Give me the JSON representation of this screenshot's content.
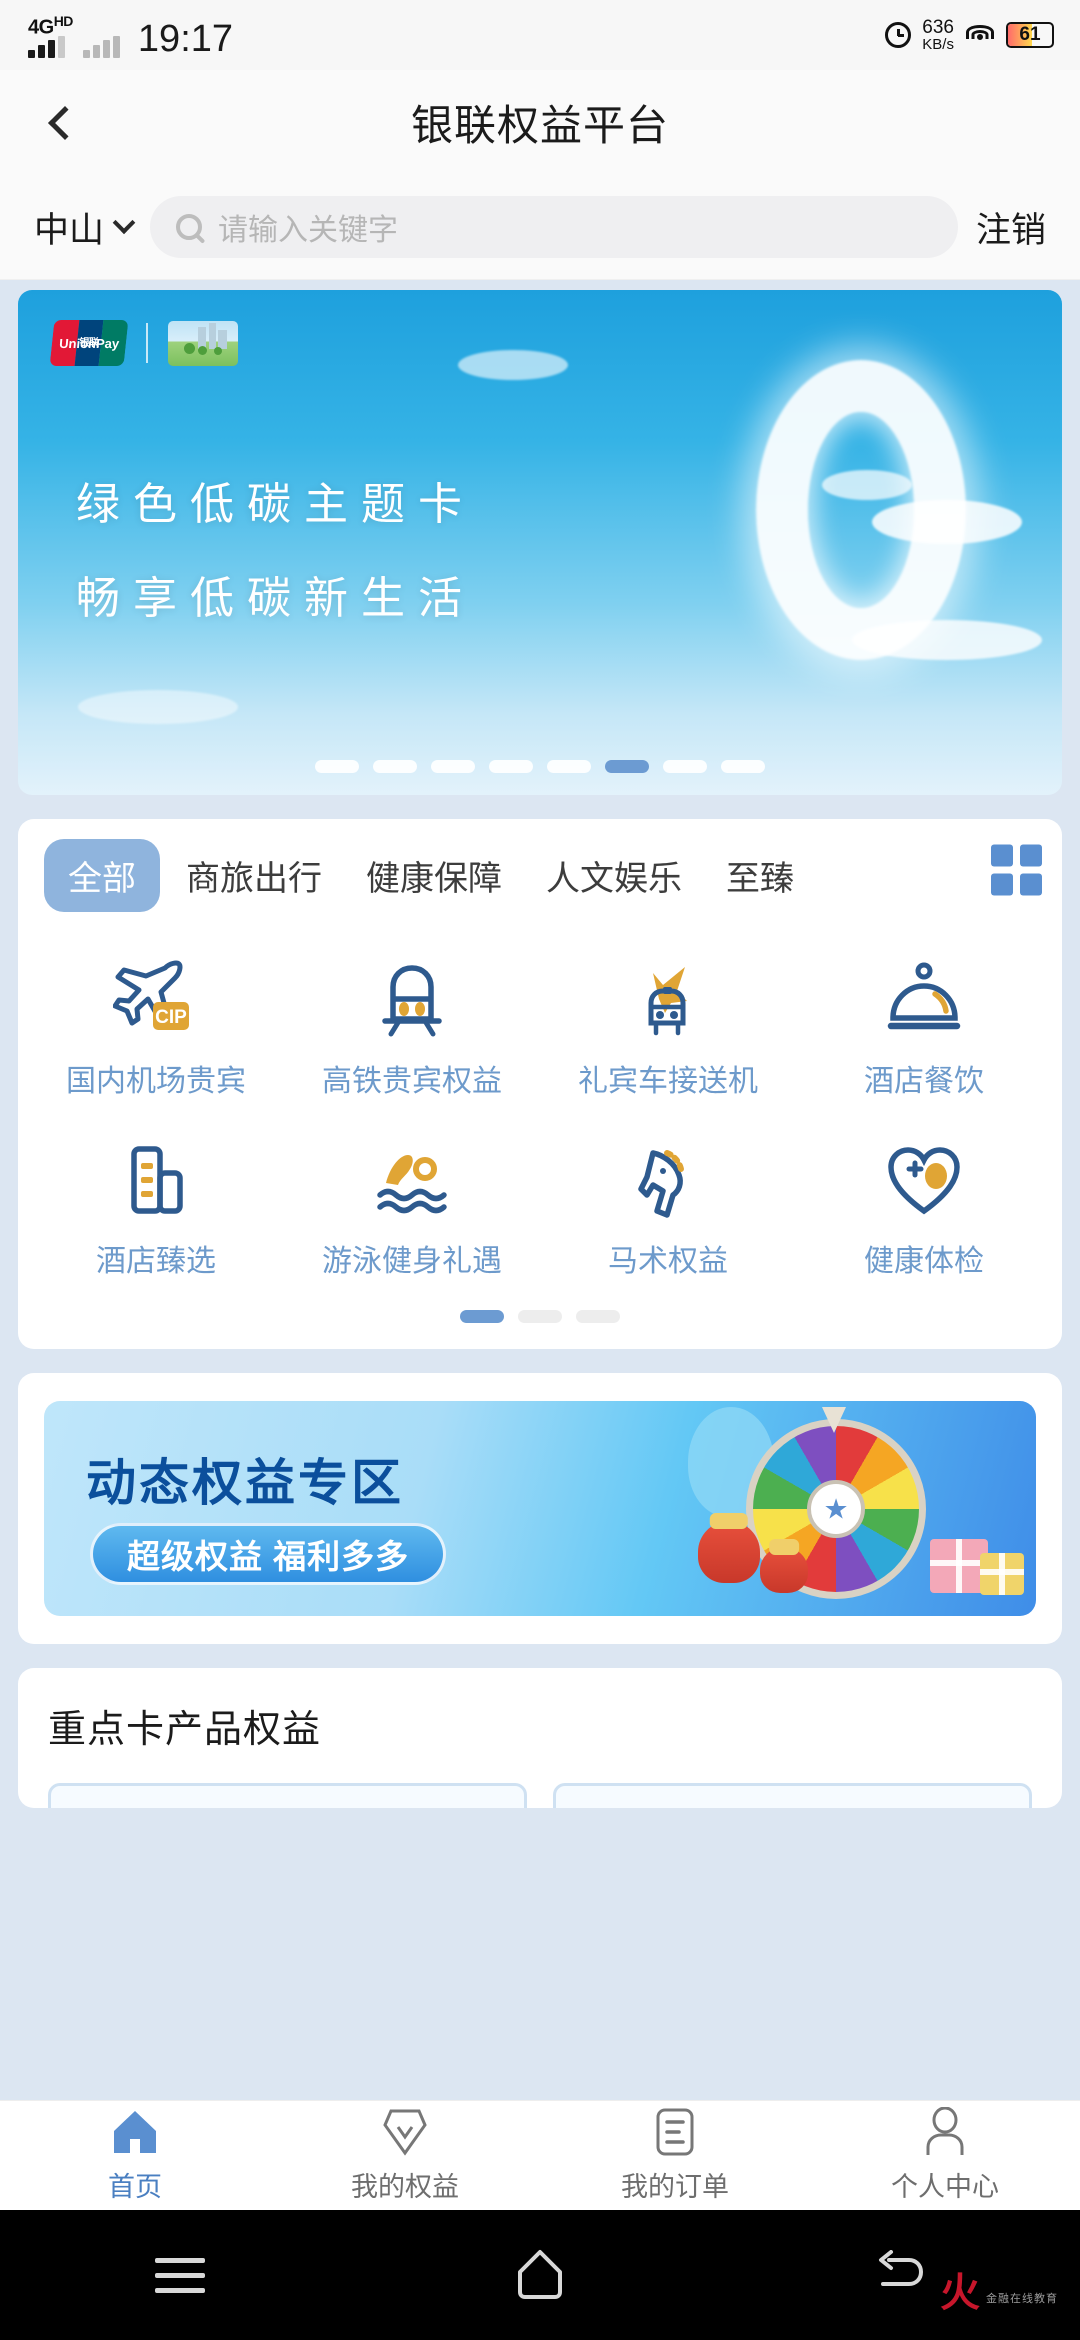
{
  "status_bar": {
    "network": "4G",
    "network_hd": "HD",
    "time": "19:17",
    "data_rate_value": "636",
    "data_rate_unit": "KB/s",
    "battery_percent": "61",
    "icons": [
      "signal-bars-icon",
      "signal-bars-secondary-icon",
      "alarm-icon",
      "wifi-icon",
      "battery-icon"
    ]
  },
  "header": {
    "back_icon": "chevron-left-icon",
    "title": "银联权益平台"
  },
  "search_row": {
    "city": "中山",
    "city_caret_icon": "chevron-down-icon",
    "search_icon": "search-icon",
    "search_placeholder": "请输入关键字",
    "search_value": "",
    "logout_label": "注销"
  },
  "hero": {
    "brand_logo": "unionpay-logo",
    "brand_logo_text": "UnionPay",
    "brand_logo_cn": "银联",
    "card_thumbnail": "green-card-thumbnail",
    "line1": "绿色低碳主题卡",
    "line2": "畅享低碳新生活",
    "dots_total": 8,
    "dots_active_index": 5,
    "accent": "#6c9bd2"
  },
  "categories": {
    "tabs": [
      {
        "label": "全部",
        "active": true
      },
      {
        "label": "商旅出行",
        "active": false
      },
      {
        "label": "健康保障",
        "active": false
      },
      {
        "label": "人文娱乐",
        "active": false
      },
      {
        "label": "至臻",
        "active": false
      }
    ],
    "expand_icon": "grid-expand-icon",
    "active_tab_color": "#8fb4dd",
    "label_color": "#6d9acb",
    "items": [
      {
        "label": "国内机场贵宾",
        "icon": "airplane-cip-icon"
      },
      {
        "label": "高铁贵宾权益",
        "icon": "train-icon"
      },
      {
        "label": "礼宾车接送机",
        "icon": "car-airplane-icon"
      },
      {
        "label": "酒店餐饮",
        "icon": "cloche-dining-icon"
      },
      {
        "label": "酒店臻选",
        "icon": "hotel-building-icon"
      },
      {
        "label": "游泳健身礼遇",
        "icon": "swimming-icon"
      },
      {
        "label": "马术权益",
        "icon": "horse-icon"
      },
      {
        "label": "健康体检",
        "icon": "heart-checkup-icon"
      }
    ],
    "page_dots_total": 3,
    "page_dots_active_index": 0
  },
  "promo": {
    "title": "动态权益专区",
    "pill_label": "超级权益 福利多多",
    "title_color": "#0b4f9c",
    "decor_icons": [
      "prize-wheel-icon",
      "money-pouch-icon",
      "gift-box-icon",
      "balloon-icon"
    ]
  },
  "section": {
    "title": "重点卡产品权益"
  },
  "tabbar": {
    "items": [
      {
        "label": "首页",
        "icon": "home-icon",
        "active": true
      },
      {
        "label": "我的权益",
        "icon": "benefit-badge-icon",
        "active": false
      },
      {
        "label": "我的订单",
        "icon": "order-list-icon",
        "active": false
      },
      {
        "label": "个人中心",
        "icon": "person-icon",
        "active": false
      }
    ],
    "active_color": "#4a7fc1",
    "inactive_color": "#6e6e6e"
  },
  "android_nav": {
    "items": [
      {
        "icon": "recents-menu-icon",
        "label": ""
      },
      {
        "icon": "home-nav-icon",
        "label": ""
      },
      {
        "icon": "back-nav-icon",
        "label": ""
      }
    ],
    "watermark_mark": "火",
    "watermark_text": "金融在线教育"
  }
}
